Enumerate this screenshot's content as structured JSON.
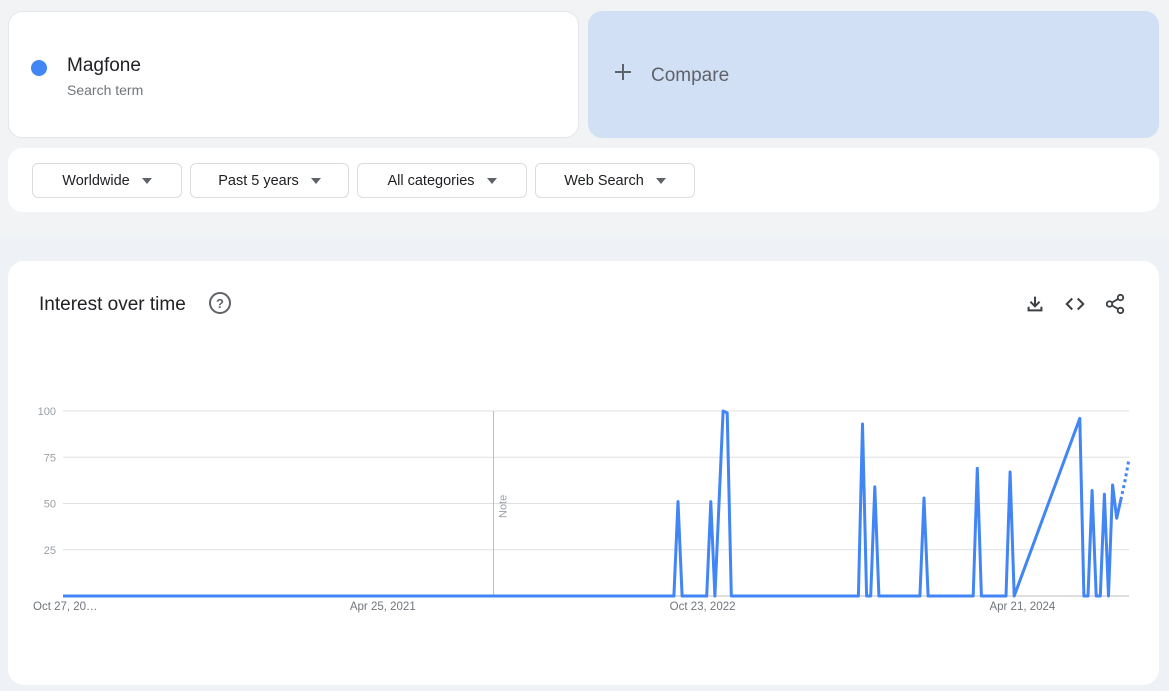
{
  "search_term": {
    "name": "Magfone",
    "type": "Search term",
    "color": "#4285f4"
  },
  "compare": {
    "label": "Compare"
  },
  "filters": [
    {
      "label": "Worldwide"
    },
    {
      "label": "Past 5 years"
    },
    {
      "label": "All categories"
    },
    {
      "label": "Web Search"
    }
  ],
  "interest_panel": {
    "title": "Interest over time",
    "help_icon": "help-circle-icon",
    "actions": [
      "download-icon",
      "embed-code-icon",
      "share-icon"
    ]
  },
  "chart_data": {
    "type": "line",
    "title": "Interest over time",
    "xlabel": "",
    "ylabel": "",
    "ylim": [
      0,
      100
    ],
    "grid": true,
    "y_ticks": [
      "100",
      "75",
      "50",
      "25"
    ],
    "x_ticks": [
      "Oct 27, 20…",
      "Apr 25, 2021",
      "Oct 23, 2022",
      "Apr 21, 2024"
    ],
    "annotations": [
      {
        "label": "Note",
        "date": "2021-10-31"
      }
    ],
    "series": [
      {
        "color": "#4285f4",
        "x": [
          "2019-10-27",
          "2021-04-25",
          "2022-09-04",
          "2022-09-11",
          "2022-09-18",
          "2022-10-30",
          "2022-11-06",
          "2022-11-13",
          "2022-11-27",
          "2022-12-04",
          "2022-12-11",
          "2022-12-18",
          "2023-07-16",
          "2023-07-23",
          "2023-07-30",
          "2023-08-06",
          "2023-08-13",
          "2023-08-20",
          "2023-08-27",
          "2023-09-03",
          "2023-10-29",
          "2023-11-05",
          "2023-11-12",
          "2024-01-28",
          "2024-02-04",
          "2024-02-11",
          "2024-03-24",
          "2024-03-31",
          "2024-04-07",
          "2024-07-28",
          "2024-08-04",
          "2024-08-11",
          "2024-08-18",
          "2024-08-25",
          "2024-09-01",
          "2024-09-08",
          "2024-09-15",
          "2024-09-22",
          "2024-09-29",
          "2024-10-06",
          "2024-10-13",
          "2024-10-20"
        ],
        "values": [
          0,
          0,
          0,
          51,
          0,
          0,
          51,
          0,
          100,
          99,
          0,
          0,
          0,
          93,
          0,
          0,
          59,
          0,
          0,
          0,
          0,
          53,
          0,
          0,
          69,
          0,
          0,
          67,
          0,
          96,
          0,
          0,
          57,
          0,
          0,
          55,
          0,
          60,
          42,
          52,
          62,
          74
        ],
        "partial_from_index": 39
      }
    ]
  }
}
